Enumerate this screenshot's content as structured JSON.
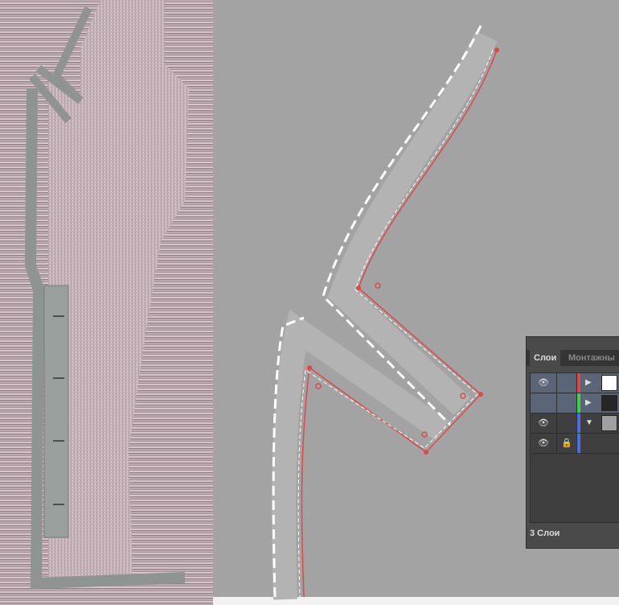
{
  "layers_panel": {
    "tabs": [
      {
        "label": "Слои",
        "active": true
      },
      {
        "label": "Монтажны",
        "active": false
      }
    ],
    "layers": [
      {
        "visible": true,
        "locked": false,
        "color": "#e04848",
        "expanded": false,
        "thumb": "#ffffff",
        "selected": true
      },
      {
        "visible": false,
        "locked": false,
        "color": "#40d040",
        "expanded": false,
        "thumb": "#262626",
        "selected": true
      },
      {
        "visible": true,
        "locked": false,
        "color": "#4a70e0",
        "expanded": true,
        "thumb": "#a0a0a0",
        "selected": false
      },
      {
        "visible": true,
        "locked": true,
        "color": "#4a70e0",
        "expanded": null,
        "thumb": null,
        "selected": false
      }
    ],
    "footer": "3 Слои"
  },
  "icons": {
    "eye": "eye-icon",
    "lock": "lock-icon",
    "expand": "triangle-right-icon",
    "collapse": "triangle-down-icon"
  }
}
